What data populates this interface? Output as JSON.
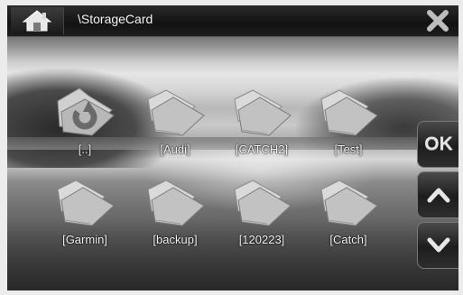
{
  "header": {
    "path": "\\StorageCard",
    "home_icon": "home-icon",
    "close_icon": "close-x-icon"
  },
  "folders": [
    {
      "label": "[..]",
      "icon": "folder-up-icon"
    },
    {
      "label": "[Audi]",
      "icon": "folder-icon"
    },
    {
      "label": "[CATCH2]",
      "icon": "folder-icon"
    },
    {
      "label": "[Test]",
      "icon": "folder-icon"
    },
    {
      "label": "[Garmin]",
      "icon": "folder-icon"
    },
    {
      "label": "[backup]",
      "icon": "folder-icon"
    },
    {
      "label": "[120223]",
      "icon": "folder-icon"
    },
    {
      "label": "[Catch]",
      "icon": "folder-icon"
    }
  ],
  "side_buttons": {
    "ok_label": "OK",
    "up_icon": "chevron-up-icon",
    "down_icon": "chevron-down-icon"
  }
}
